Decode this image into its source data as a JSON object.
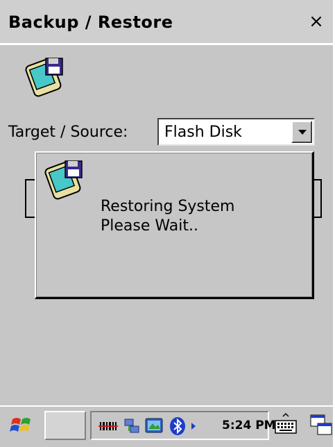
{
  "window": {
    "title": "Backup / Restore",
    "close_label": "×"
  },
  "form": {
    "target_label": "Target / Source:",
    "target_value": "Flash Disk"
  },
  "dialog": {
    "line1": "Restoring System",
    "line2": "Please Wait.."
  },
  "taskbar": {
    "clock": "5:24 PM",
    "icons": [
      "start-flag-icon",
      "barcode-icon",
      "network-icon",
      "display-icon",
      "bluetooth-icon",
      "tray-arrow-icon",
      "keyboard-icon",
      "window-switch-icon"
    ]
  },
  "colors": {
    "background": "#c6c6c6",
    "accent_blue": "#1e3cc8",
    "icon_teal": "#48c8c8"
  }
}
